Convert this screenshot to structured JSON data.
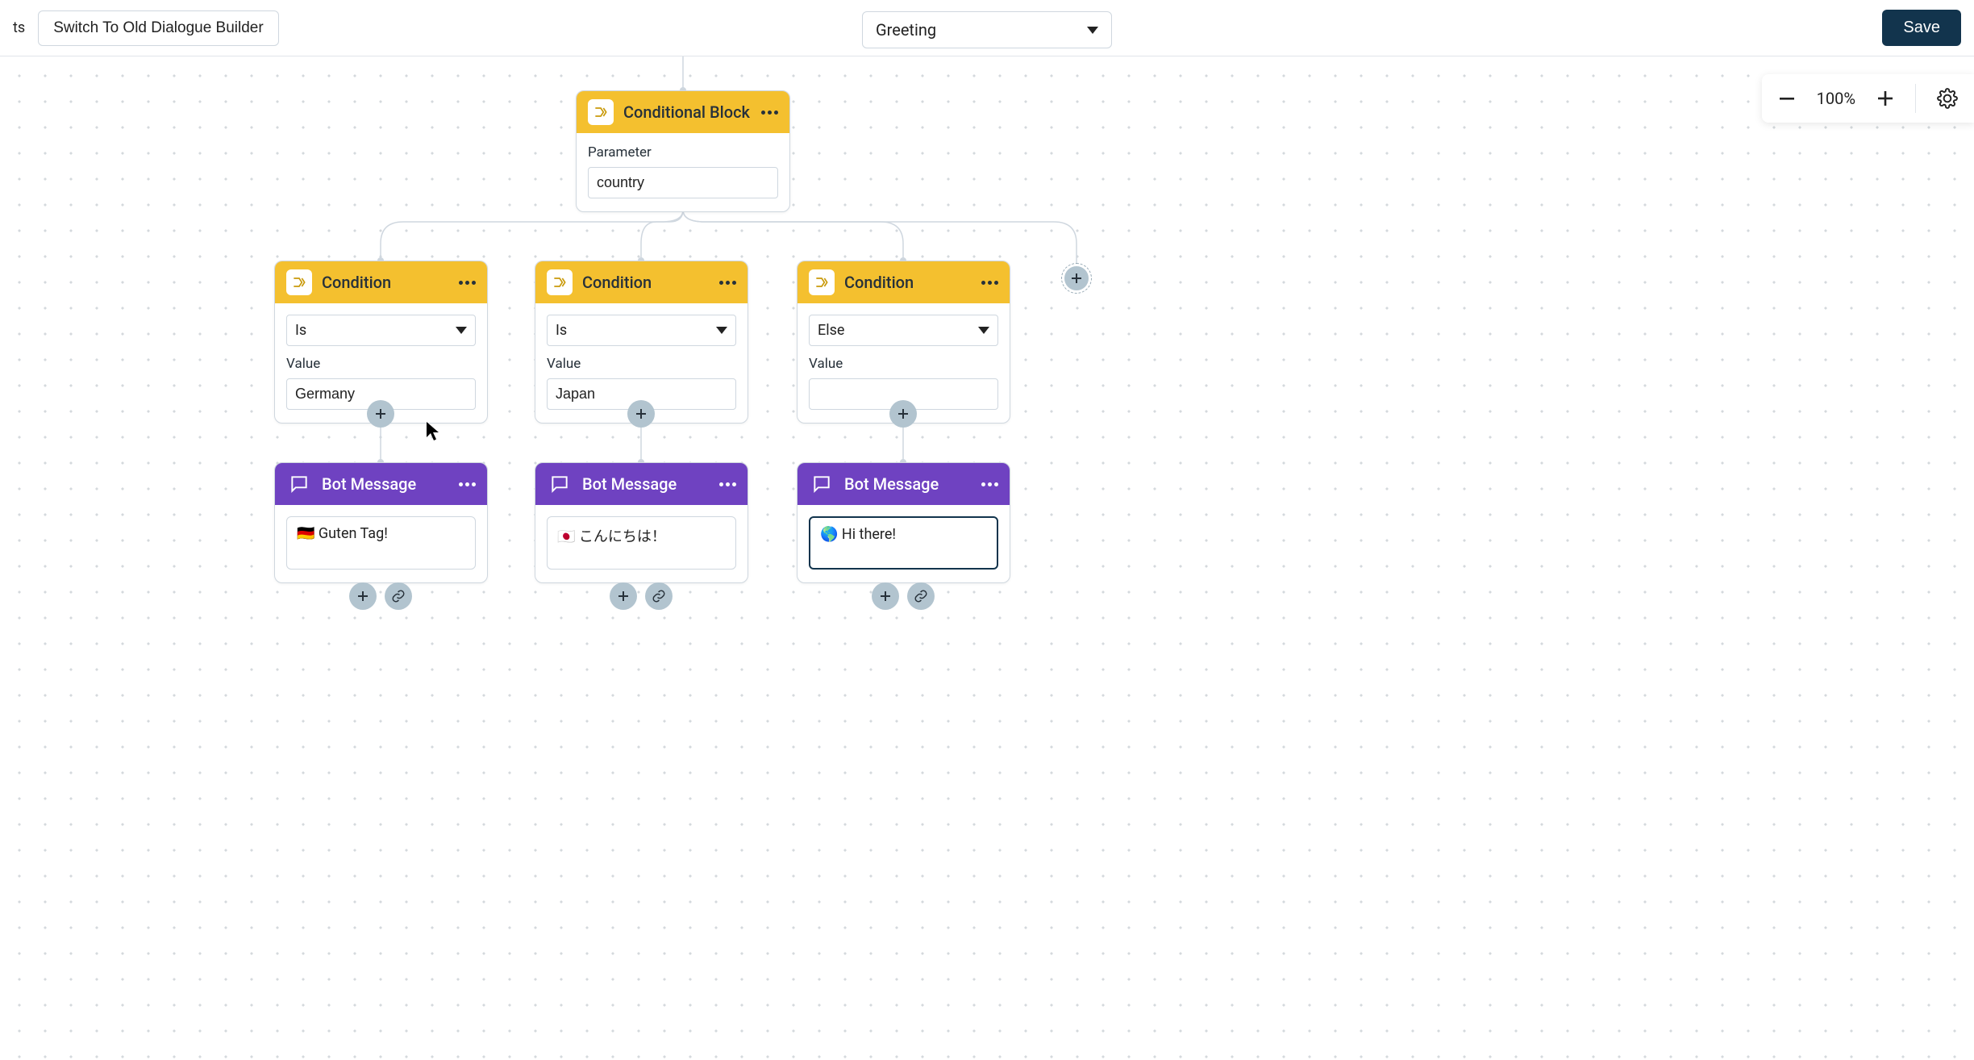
{
  "toolbar": {
    "left_truncated_label": "ts",
    "switch_label": "Switch To Old Dialogue Builder",
    "dialogue_selected": "Greeting",
    "save_label": "Save"
  },
  "zoom": {
    "level_label": "100%"
  },
  "nodes": {
    "conditional_block": {
      "title": "Conditional Block",
      "param_label": "Parameter",
      "param_value": "country"
    },
    "condition1": {
      "title": "Condition",
      "operator": "Is",
      "value_label": "Value",
      "value": "Germany"
    },
    "condition2": {
      "title": "Condition",
      "operator": "Is",
      "value_label": "Value",
      "value": "Japan"
    },
    "condition3": {
      "title": "Condition",
      "operator": "Else",
      "value_label": "Value",
      "value": ""
    },
    "bot1": {
      "title": "Bot Message",
      "message": "🇩🇪 Guten Tag!"
    },
    "bot2": {
      "title": "Bot Message",
      "message": "🇯🇵 こんにちは！"
    },
    "bot3": {
      "title": "Bot Message",
      "message": "🌎 Hi there!"
    }
  }
}
